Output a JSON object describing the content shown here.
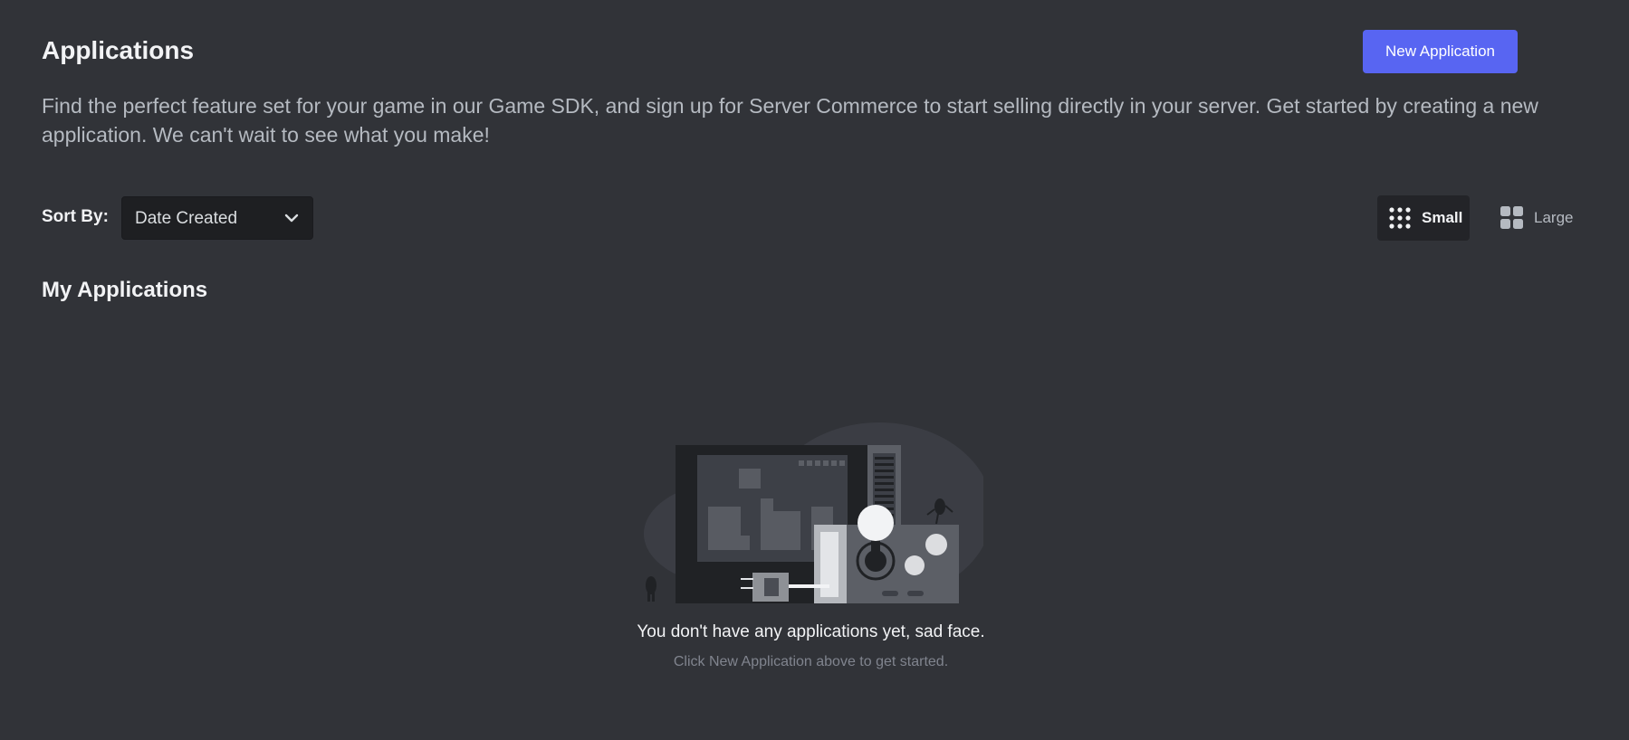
{
  "header": {
    "title": "Applications",
    "new_app_label": "New Application",
    "description": "Find the perfect feature set for your game in our Game SDK, and sign up for Server Commerce to start selling directly in your server. Get started by creating a new application. We can't wait to see what you make!"
  },
  "sort": {
    "label": "Sort By:",
    "selected": "Date Created"
  },
  "view_toggle": {
    "small_label": "Small",
    "large_label": "Large",
    "selected": "Small"
  },
  "section": {
    "title": "My Applications"
  },
  "empty_state": {
    "title": "You don't have any applications yet, sad face.",
    "subtitle": "Click New Application above to get started."
  },
  "colors": {
    "background": "#313338",
    "accent": "#5865f2",
    "select_bg": "#1e1f22",
    "muted_text": "#80848e"
  },
  "icons": {
    "chevron": "chevron-down-icon",
    "small_grid": "small-grid-icon",
    "large_grid": "large-grid-icon"
  }
}
